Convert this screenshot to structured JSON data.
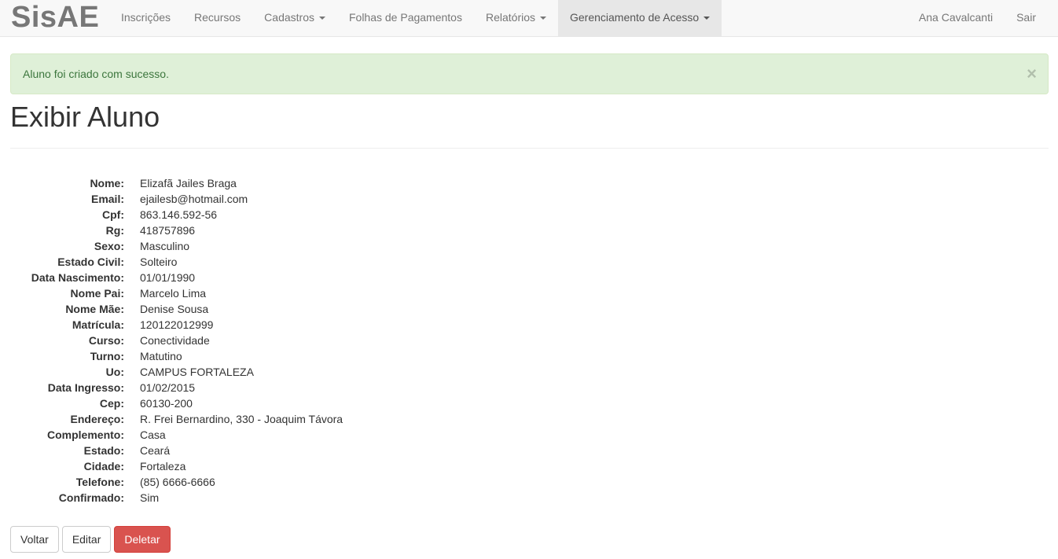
{
  "navbar": {
    "brand": "SisAE",
    "items": [
      {
        "label": "Inscrições",
        "dropdown": false,
        "active": false
      },
      {
        "label": "Recursos",
        "dropdown": false,
        "active": false
      },
      {
        "label": "Cadastros",
        "dropdown": true,
        "active": false
      },
      {
        "label": "Folhas de Pagamentos",
        "dropdown": false,
        "active": false
      },
      {
        "label": "Relatórios",
        "dropdown": true,
        "active": false
      },
      {
        "label": "Gerenciamento de Acesso",
        "dropdown": true,
        "active": true
      }
    ],
    "user": "Ana Cavalcanti",
    "logout": "Sair"
  },
  "alert": {
    "message": "Aluno foi criado com sucesso.",
    "close_glyph": "×"
  },
  "page": {
    "title": "Exibir Aluno"
  },
  "details": [
    {
      "label": "Nome:",
      "value": "Elizafã Jailes Braga"
    },
    {
      "label": "Email:",
      "value": "ejailesb@hotmail.com"
    },
    {
      "label": "Cpf:",
      "value": "863.146.592-56"
    },
    {
      "label": "Rg:",
      "value": "418757896"
    },
    {
      "label": "Sexo:",
      "value": "Masculino"
    },
    {
      "label": "Estado Civil:",
      "value": "Solteiro"
    },
    {
      "label": "Data Nascimento:",
      "value": "01/01/1990"
    },
    {
      "label": "Nome Pai:",
      "value": "Marcelo Lima"
    },
    {
      "label": "Nome Mãe:",
      "value": "Denise Sousa"
    },
    {
      "label": "Matrícula:",
      "value": "120122012999"
    },
    {
      "label": "Curso:",
      "value": "Conectividade"
    },
    {
      "label": "Turno:",
      "value": "Matutino"
    },
    {
      "label": "Uo:",
      "value": "CAMPUS FORTALEZA"
    },
    {
      "label": "Data Ingresso:",
      "value": "01/02/2015"
    },
    {
      "label": "Cep:",
      "value": "60130-200"
    },
    {
      "label": "Endereço:",
      "value": "R. Frei Bernardino, 330 - Joaquim Távora"
    },
    {
      "label": "Complemento:",
      "value": "Casa"
    },
    {
      "label": "Estado:",
      "value": "Ceará"
    },
    {
      "label": "Cidade:",
      "value": "Fortaleza"
    },
    {
      "label": "Telefone:",
      "value": "(85) 6666-6666"
    },
    {
      "label": "Confirmado:",
      "value": "Sim"
    }
  ],
  "actions": {
    "back": "Voltar",
    "edit": "Editar",
    "delete": "Deletar"
  },
  "colors": {
    "navbar_bg": "#f8f8f8",
    "alert_bg": "#dff0d8",
    "alert_text": "#3c763d",
    "danger": "#d9534f"
  }
}
